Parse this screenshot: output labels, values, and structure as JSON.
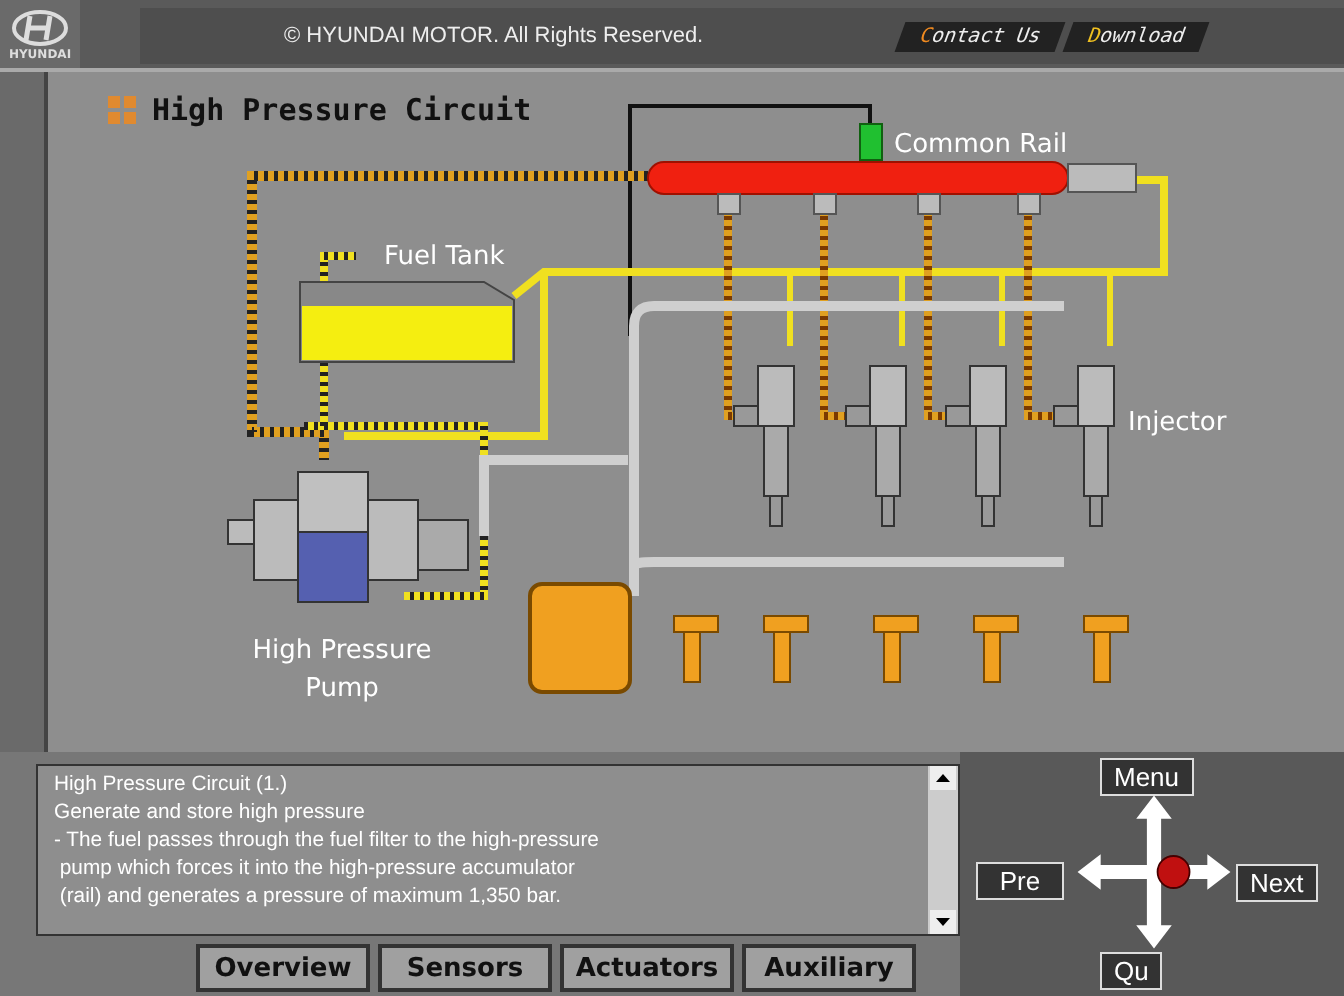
{
  "header": {
    "logo_text": "HYUNDAI",
    "copyright": "© HYUNDAI MOTOR. All Rights Reserved.",
    "links": [
      {
        "label": "Contact Us"
      },
      {
        "label": "Download"
      }
    ]
  },
  "title": "High Pressure Circuit",
  "diagram": {
    "labels": [
      {
        "kind": "rail",
        "text": "Common Rail"
      },
      {
        "kind": "tank",
        "text": "Fuel Tank"
      },
      {
        "kind": "injector",
        "text": "Injector"
      },
      {
        "kind": "pump",
        "text": "High Pressure"
      },
      {
        "kind": "pump2",
        "text": "Pump"
      }
    ]
  },
  "description": {
    "lines": [
      "High Pressure Circuit (1.)",
      "Generate and store high pressure",
      "- The fuel passes through the fuel filter to the high-pressure",
      " pump which forces it into the high-pressure accumulator",
      " (rail) and generates a pressure of maximum 1,350 bar."
    ]
  },
  "tabs": [
    {
      "label": "Overview",
      "selected": false
    },
    {
      "label": "Sensors",
      "selected": false
    },
    {
      "label": "Actuators",
      "selected": false
    },
    {
      "label": "Auxiliary",
      "selected": false
    }
  ],
  "nav": {
    "menu": "Menu",
    "pre": "Pre",
    "next": "Next",
    "quit": "Qu"
  }
}
